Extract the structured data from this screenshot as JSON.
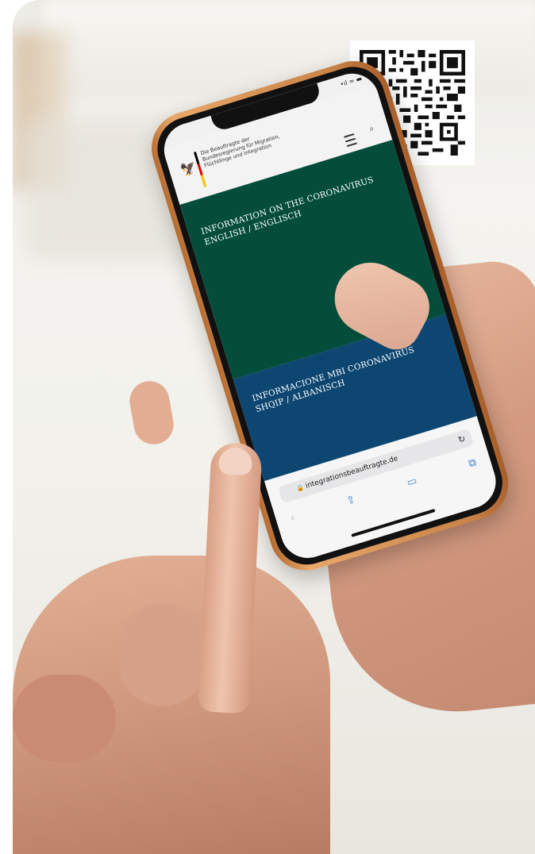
{
  "photo": {
    "description_tag": "hands-holding-smartphone",
    "qr_code": {
      "icon": "qr-code-icon"
    },
    "phone_screen": {
      "status": {
        "signal": "•ıl ≈ ▬"
      },
      "header": {
        "ministry_name": "Die Beauftragte der Bundesregierung für Migration, Flüchtlinge und Integration",
        "menu_icon": "hamburger-menu-icon",
        "search_icon": "search-icon"
      },
      "panels": [
        {
          "title_line1": "INFORMATION ON THE CORONAVIRUS",
          "title_line2": "ENGLISH / ENGLISCH",
          "color": "#034d3a"
        },
        {
          "title_line1": "INFORMACIONE MBI CORONAVIRUS",
          "title_line2": "SHQIP / ALBANISCH",
          "color": "#0d4670"
        }
      ],
      "browser": {
        "url": "integrationsbeauftragte.de",
        "reload_icon": "reload-icon",
        "lock_icon": "lock-icon",
        "toolbar_icons": [
          "back-icon",
          "share-icon",
          "bookmarks-icon",
          "tabs-icon"
        ]
      }
    }
  }
}
